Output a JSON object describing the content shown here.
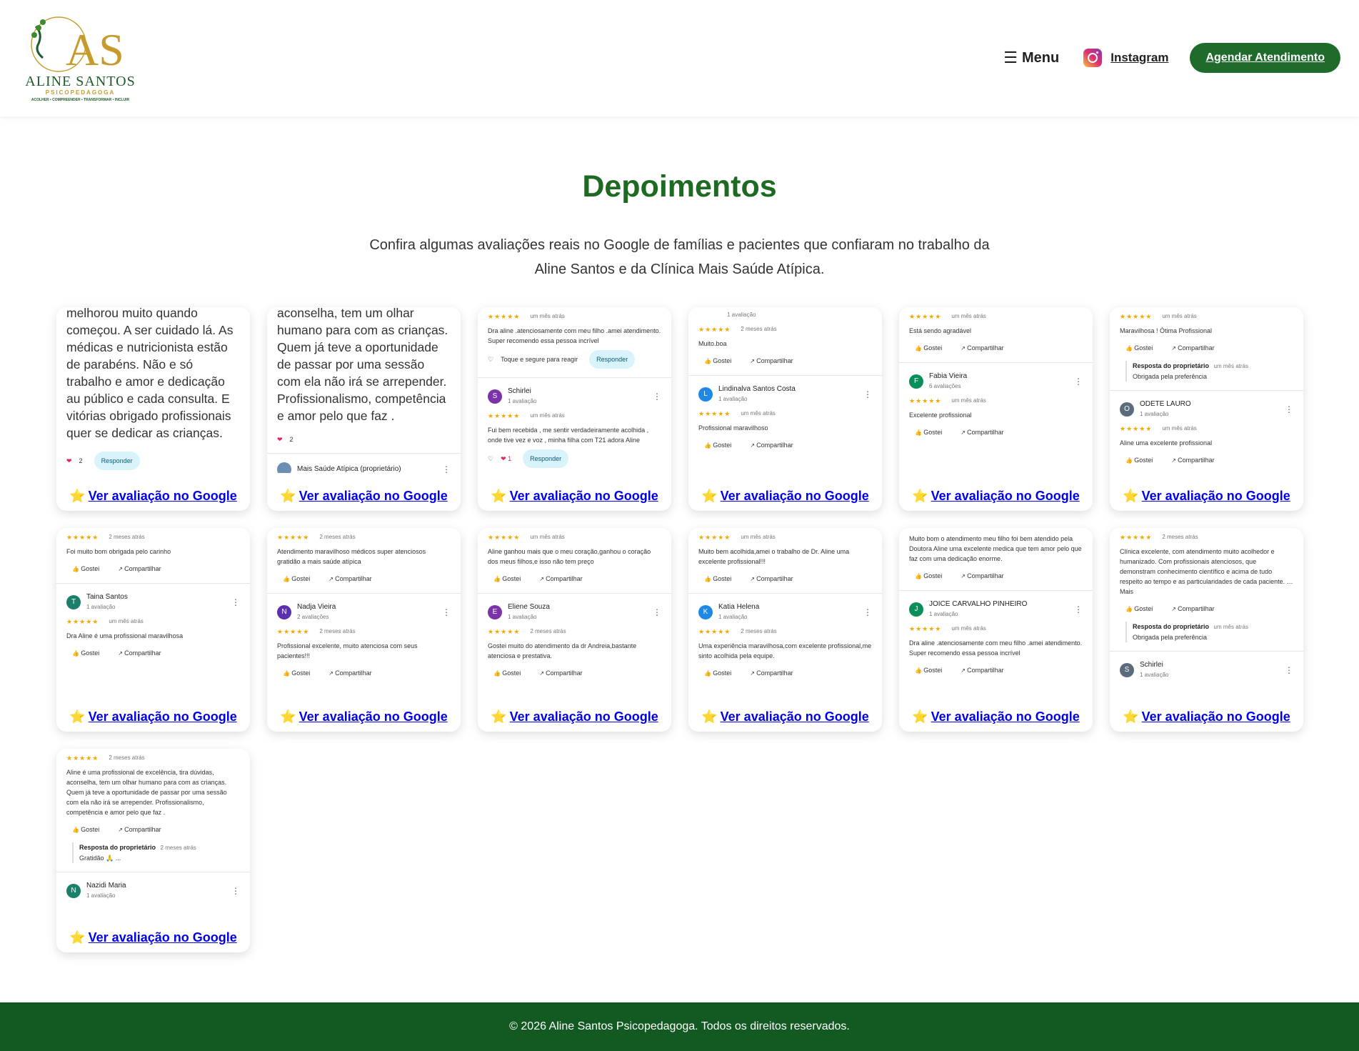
{
  "brand": {
    "name": "ALINE SANTOS",
    "subtitle": "PSICOPEDAGOGA",
    "tagline": "ACOLHER • COMPREENDER • TRANSFORMAR • INCLUIR",
    "monogram": "AS",
    "colors": {
      "green": "#1f6b2b",
      "gold": "#c79a2c"
    }
  },
  "nav": {
    "menu": "Menu",
    "instagram": "Instagram",
    "cta": "Agendar Atendimento"
  },
  "section": {
    "title": "Depoimentos",
    "intro": "Confira algumas avaliações reais no Google de famílias e pacientes que confiaram no trabalho da Aline Santos e da Clínica Mais Saúde Atípica."
  },
  "link_label": "Ver avaliação no Google",
  "cards": [
    {
      "big": "melhorou muito quando começou. A ser cuidado lá. As médicas  e nutricionista estão de parabéns. Não e só trabalho e amor e dedicação au público e cada consulta. E vitórias  obrigado profissionais quer se dedicar as crianças.",
      "likes": "2",
      "respond": "Responder"
    },
    {
      "big": "aconselha, tem um olhar humano para com as crianças. Quem já teve a oportunidade de passar por uma sessão com ela não irá se arrepender. Profissionalismo, competência e amor pelo que faz .",
      "likes": "2",
      "owner": "Mais Saúde Atípica (proprietário)"
    },
    {
      "time": "um mês atrás",
      "text": "Dra aline .atenciosamente com meu filho .amei atendimento. Super recomendo essa pessoa incrível",
      "tap": "Toque e segure para reagir",
      "respond": "Responder",
      "name": "Schirlei",
      "count": "1 avaliação",
      "time2": "um mês atrás",
      "text2": "Fui bem recebida , me sentir verdadeiramente acolhida , onde tive vez e voz , minha filha com T21 adora Aline",
      "likes": "1"
    },
    {
      "count0": "1 avaliação",
      "time": "2 meses atrás",
      "text": "Muito.boa",
      "like": "Gostei",
      "share": "Compartilhar",
      "name": "Lindinalva Santos Costa",
      "count": "1 avaliação",
      "time2": "um mês atrás",
      "text2": "Profissional maravilhoso"
    },
    {
      "time": "um mês atrás",
      "text": "Está sendo agradável",
      "name": "Fabia Vieira",
      "count": "6 avaliações",
      "time2": "um mês atrás",
      "text2": "Excelente profissional"
    },
    {
      "time": "um mês atrás",
      "text": "Maravilhosa  ! Ótima Profissional",
      "owner_label": "Resposta do proprietário",
      "owner_time": "um mês atrás",
      "owner_text": "Obrigada pela preferência",
      "name": "ODETE LAURO",
      "count": "1 avaliação",
      "time2": "um mês atrás",
      "text2": "Aline uma excelente profissional"
    },
    {
      "time": "2 meses atrás",
      "text": "Foi muito bom obrigada pelo carinho",
      "name": "Taina Santos",
      "count": "1 avaliação",
      "time2": "um mês atrás",
      "text2": "Dra Aline é uma profissional maravilhosa"
    },
    {
      "time": "2 meses atrás",
      "text": "Atendimento maravilhoso médicos super atenciosos gratidão a mais saúde atípica",
      "name": "Nadja Vieira",
      "count": "2 avaliações",
      "time2": "2 meses atrás",
      "text2": "Profissional excelente, muito atenciosa com seus pacientes!!!"
    },
    {
      "time": "um mês atrás",
      "text": "Aline ganhou mais que o meu coração,ganhou o coração dos meus filhos,e isso não tem preço",
      "name": "Eliene Souza",
      "count": "1 avaliação",
      "time2": "2 meses atrás",
      "text2": "Gostei muito do atendimento da dr Andreia,bastante atenciosa e prestativa."
    },
    {
      "time": "um mês atrás",
      "text": "Muito bem acolhida,amei o trabalho de Dr. Aline uma excelente profissional!!!",
      "name": "Katia Helena",
      "count": "1 avaliação",
      "time2": "2 meses atrás",
      "text2": "Uma experiência maravilhosa,com excelente profissional,me sinto acolhida pela equipe."
    },
    {
      "text": "Muito bom o atendimento meu filho foi bem atendido pela Doutora Aline uma excelente medica que tem amor pelo que faz com uma dedicação enorme.",
      "name": "JOICE CARVALHO PINHEIRO",
      "count": "1 avaliação",
      "time2": "um mês atrás",
      "text2": "Dra aline .atenciosamente com meu filho .amei atendimento. Super recomendo essa pessoa incrível"
    },
    {
      "time": "2 meses atrás",
      "text": "Clínica excelente, com atendimento muito acolhedor e humanizado. Com profissionais atenciosos, que demonstram conhecimento científico e acima de tudo respeito ao tempo e as particularidades de cada paciente. … Mais",
      "owner_label": "Resposta do proprietário",
      "owner_time": "um mês atrás",
      "owner_text": "Obrigada pela preferência",
      "name": "Schirlei",
      "count": "1 avaliação"
    },
    {
      "time": "2 meses atrás",
      "text": "Aline é uma profissional de excelência, tira dúvidas, aconselha, tem um olhar humano para com as crianças. Quem já teve a oportunidade de passar por uma sessão com ela não irá se arrepender. Profissionalismo, competência e amor pelo que faz .",
      "owner_label": "Resposta do proprietário",
      "owner_time": "2 meses atrás",
      "owner_text": "Gratidão 🙏 ...",
      "name": "Nazidi Maria",
      "count": "1 avaliação"
    }
  ],
  "actions": {
    "like": "Gostei",
    "share": "Compartilhar"
  },
  "footer": "© 2026 Aline Santos Psicopedagoga. Todos os direitos reservados."
}
